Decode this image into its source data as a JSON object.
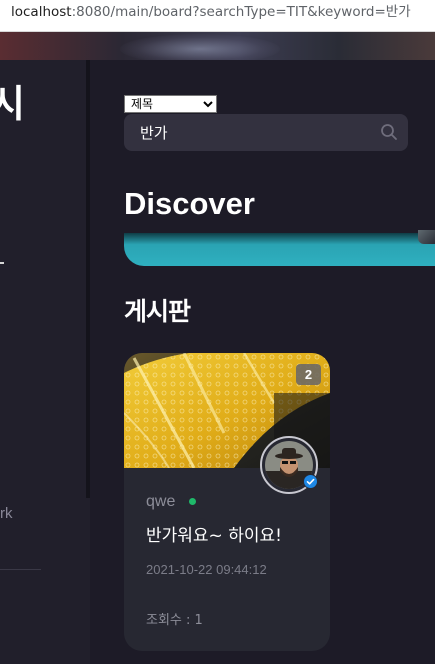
{
  "address_bar": {
    "host": "localhost",
    "rest": ":8080/main/board?searchType=TIT&keyword=반가"
  },
  "sidebar": {
    "logo_text": "시",
    "bottom_label": "rk"
  },
  "search": {
    "type_options": [
      "제목"
    ],
    "selected_type": "제목",
    "keyword_value": "반가",
    "icon": "search-icon"
  },
  "discover": {
    "title": "Discover"
  },
  "board": {
    "title": "게시판",
    "posts": [
      {
        "comment_count": "2",
        "author": "qwe",
        "author_online": true,
        "title": "반가워요~ 하이요!",
        "date": "2021-10-22 09:44:12",
        "views": "조회수 : 1",
        "verified": true
      }
    ]
  },
  "colors": {
    "background": "#1d1b27",
    "card": "#272832",
    "search_box": "#33313f",
    "accent_teal": "#2fb0c0",
    "online": "#1fb96a",
    "verified": "#1e88e5"
  }
}
